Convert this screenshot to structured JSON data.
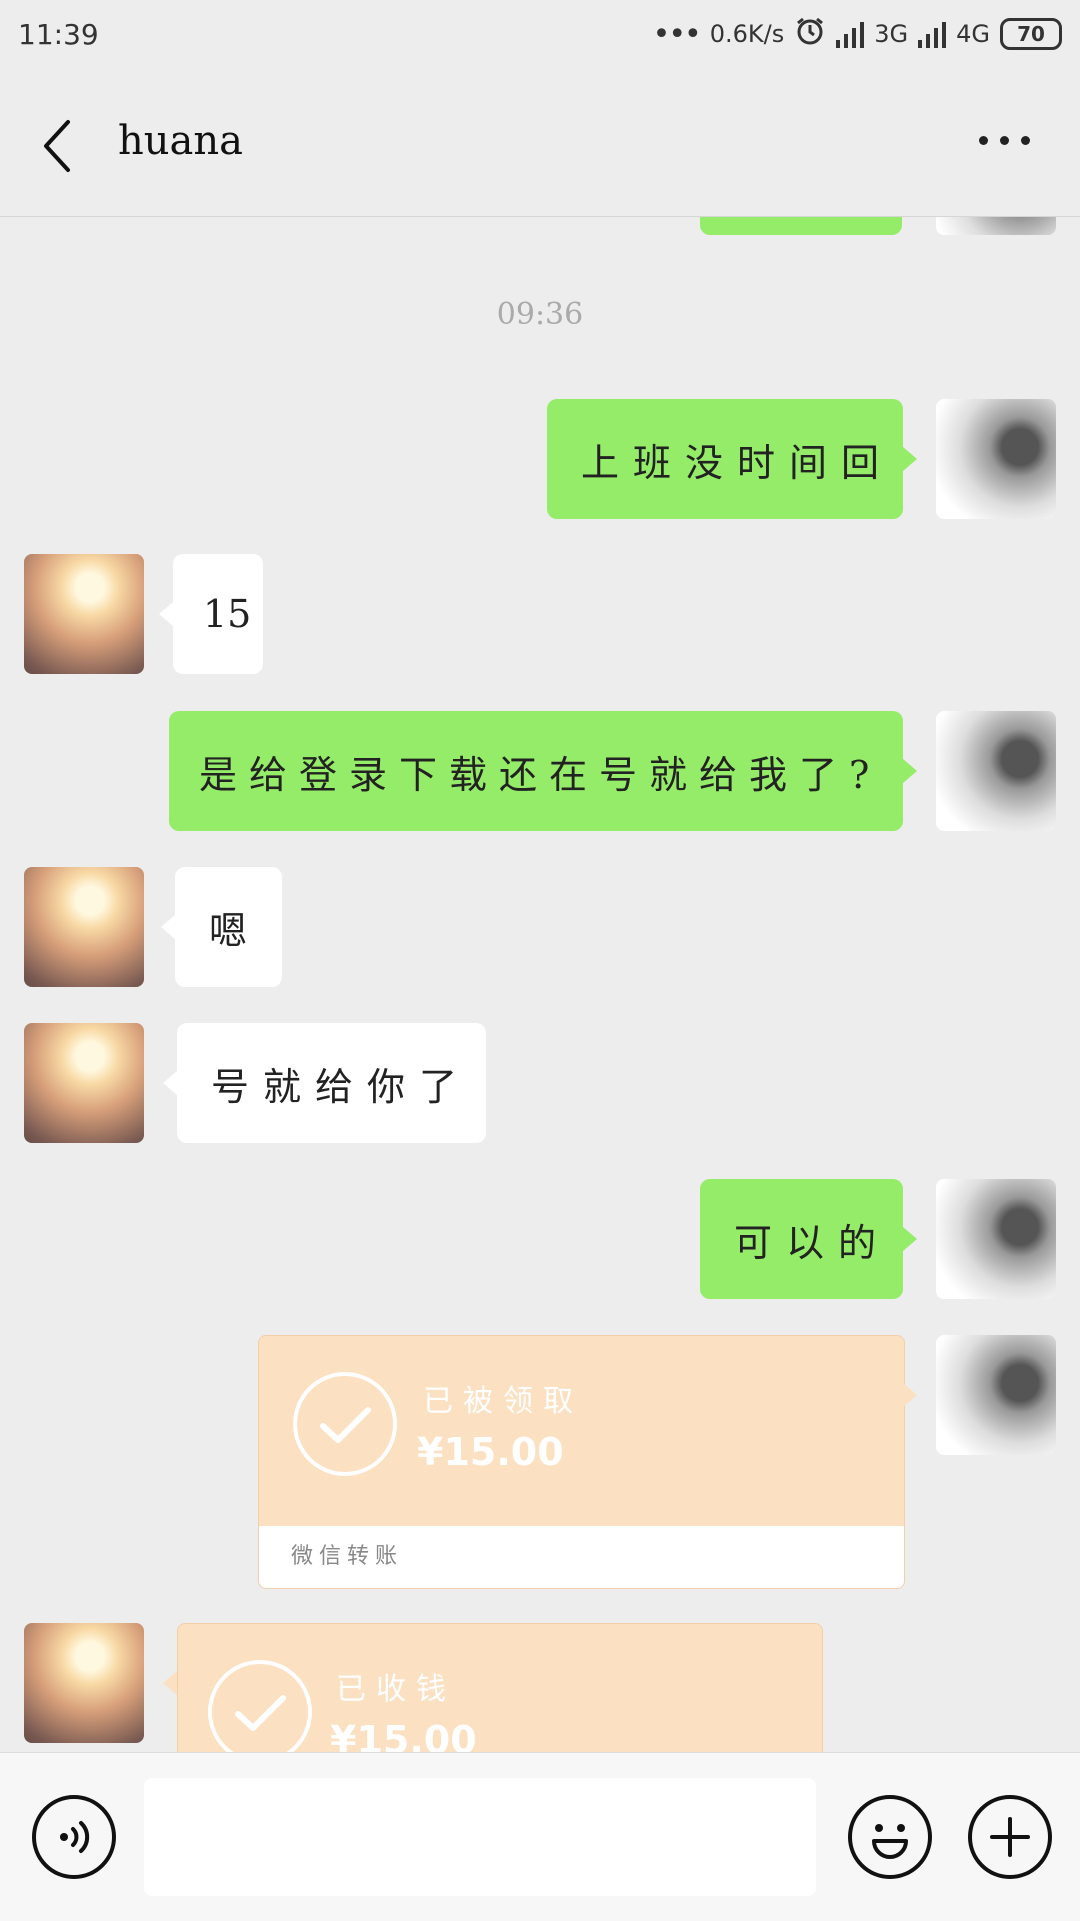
{
  "status_bar": {
    "time": "11:39",
    "net_speed": "0.6K/s",
    "net_3g": "3G",
    "net_4g": "4G",
    "battery": "70"
  },
  "header": {
    "title": "huana"
  },
  "chat": {
    "timestamp": "09:36",
    "messages": [
      {
        "from": "me",
        "text": "上班没时间回"
      },
      {
        "from": "peer",
        "text": "15"
      },
      {
        "from": "me",
        "text": "是给登录下载还在号就给我了?"
      },
      {
        "from": "peer",
        "text": "嗯"
      },
      {
        "from": "peer",
        "text": "号就给你了"
      },
      {
        "from": "me",
        "text": "可以的"
      }
    ],
    "transfers": [
      {
        "from": "me",
        "status": "已被领取",
        "amount": "¥15.00",
        "footer": "微信转账"
      },
      {
        "from": "peer",
        "status": "已收钱",
        "amount": "¥15.00"
      }
    ]
  },
  "colors": {
    "my_bubble": "#95ec69",
    "peer_bubble": "#ffffff",
    "transfer": "#fbe0c2",
    "background": "#ededed"
  },
  "icons": [
    "back-arrow-icon",
    "more-icon",
    "voice-icon",
    "emoji-icon",
    "add-icon",
    "check-icon",
    "alarm-icon"
  ]
}
